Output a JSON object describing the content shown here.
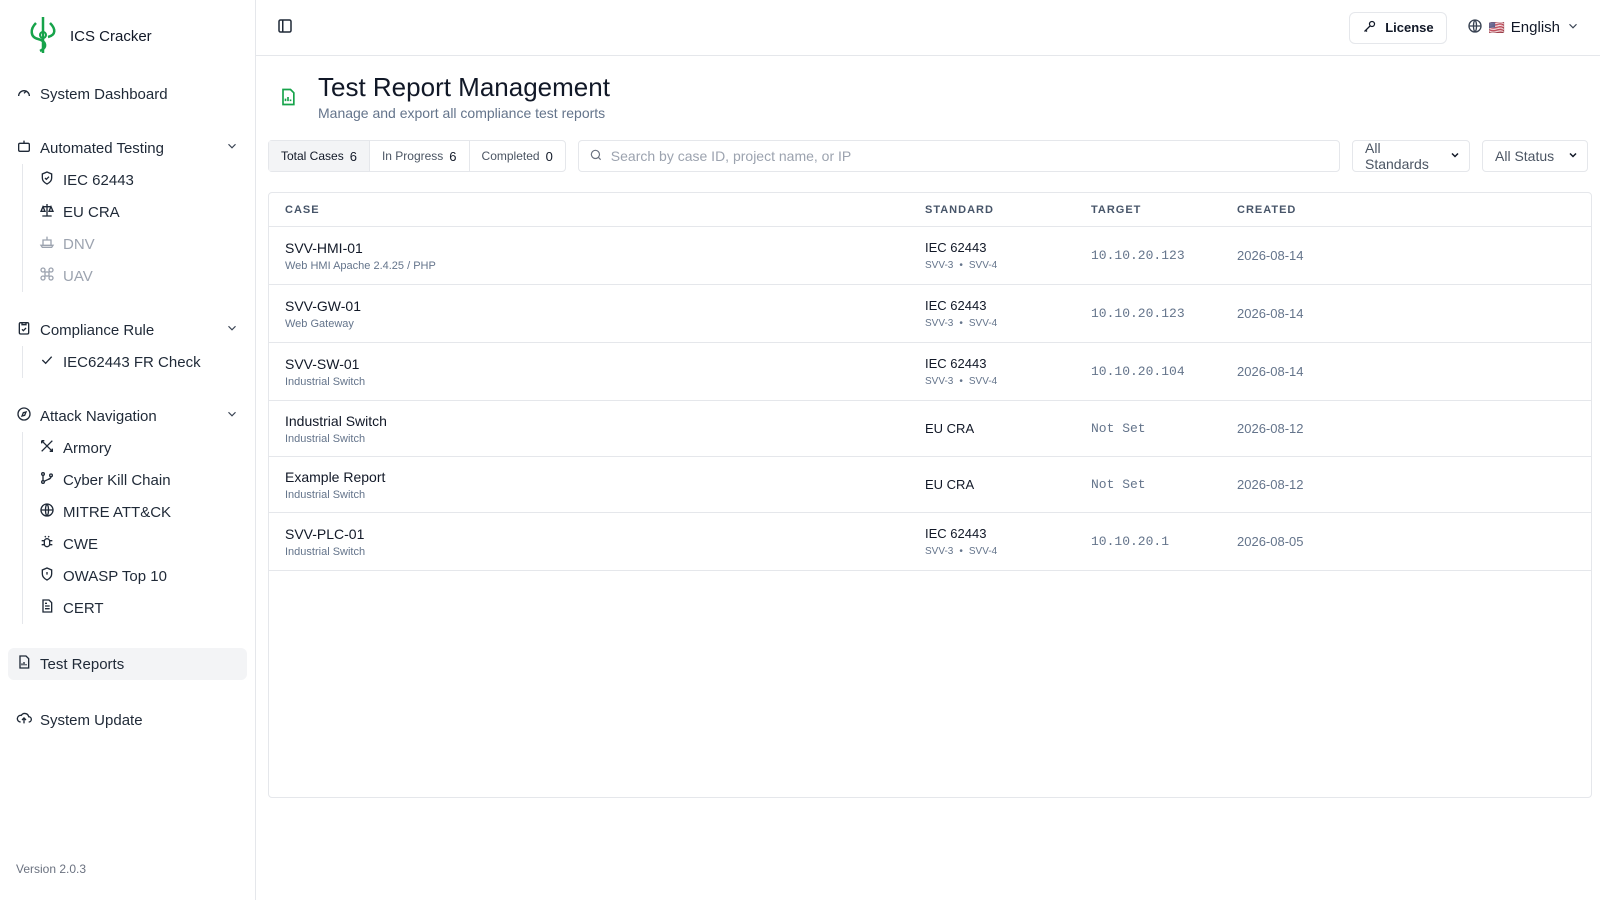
{
  "app": {
    "name": "ICS Cracker",
    "version": "Version 2.0.3"
  },
  "sidebar": {
    "dashboard": "System Dashboard",
    "automated": {
      "label": "Automated Testing",
      "items": [
        {
          "label": "IEC 62443",
          "icon": "shield-check-icon",
          "disabled": false
        },
        {
          "label": "EU CRA",
          "icon": "scale-icon",
          "disabled": false
        },
        {
          "label": "DNV",
          "icon": "ship-icon",
          "disabled": true
        },
        {
          "label": "UAV",
          "icon": "drone-icon",
          "disabled": true
        }
      ]
    },
    "compliance": {
      "label": "Compliance Rule",
      "items": [
        {
          "label": "IEC62443 FR Check",
          "icon": "check-icon"
        }
      ]
    },
    "attack": {
      "label": "Attack Navigation",
      "items": [
        {
          "label": "Armory",
          "icon": "swords-icon"
        },
        {
          "label": "Cyber Kill Chain",
          "icon": "git-branch-icon"
        },
        {
          "label": "MITRE ATT&CK",
          "icon": "globe-icon"
        },
        {
          "label": "CWE",
          "icon": "bug-icon"
        },
        {
          "label": "OWASP Top 10",
          "icon": "shield-icon"
        },
        {
          "label": "CERT",
          "icon": "file-text-icon"
        }
      ]
    },
    "reports": "Test Reports",
    "update": "System Update"
  },
  "topbar": {
    "license": "License",
    "language": "English",
    "flag": "🇺🇸"
  },
  "page": {
    "title": "Test Report Management",
    "subtitle": "Manage and export all compliance test reports"
  },
  "filters": {
    "tabs": [
      {
        "label": "Total Cases",
        "count": "6"
      },
      {
        "label": "In Progress",
        "count": "6"
      },
      {
        "label": "Completed",
        "count": "0"
      }
    ],
    "search_placeholder": "Search by case ID, project name, or IP",
    "standards": "All Standards",
    "status": "All Status"
  },
  "table": {
    "headers": {
      "case": "CASE",
      "standard": "STANDARD",
      "target": "TARGET",
      "created": "CREATED"
    },
    "rows": [
      {
        "id": "SVV-HMI-01",
        "desc": "Web HMI Apache 2.4.25 / PHP",
        "standard": "IEC 62443",
        "tag1": "SVV-3",
        "sep": "•",
        "tag2": "SVV-4",
        "target": "10.10.20.123",
        "created": "2026-08-14"
      },
      {
        "id": "SVV-GW-01",
        "desc": "Web Gateway",
        "standard": "IEC 62443",
        "tag1": "SVV-3",
        "sep": "•",
        "tag2": "SVV-4",
        "target": "10.10.20.123",
        "created": "2026-08-14"
      },
      {
        "id": "SVV-SW-01",
        "desc": "Industrial Switch",
        "standard": "IEC 62443",
        "tag1": "SVV-3",
        "sep": "•",
        "tag2": "SVV-4",
        "target": "10.10.20.104",
        "created": "2026-08-14"
      },
      {
        "id": "Industrial Switch",
        "desc": "Industrial Switch",
        "standard": "EU CRA",
        "target": "Not Set",
        "created": "2026-08-12"
      },
      {
        "id": "Example Report",
        "desc": "Industrial Switch",
        "standard": "EU CRA",
        "target": "Not Set",
        "created": "2026-08-12"
      },
      {
        "id": "SVV-PLC-01",
        "desc": "Industrial Switch",
        "standard": "IEC 62443",
        "tag1": "SVV-3",
        "sep": "•",
        "tag2": "SVV-4",
        "target": "10.10.20.1",
        "created": "2026-08-05"
      }
    ]
  },
  "colors": {
    "brand": "#16a34a",
    "accent": "#16a34a"
  }
}
